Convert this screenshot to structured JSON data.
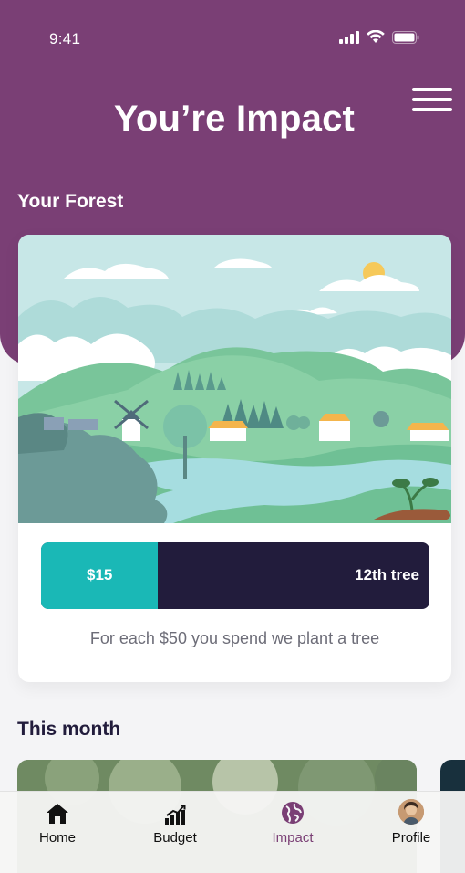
{
  "status_bar": {
    "time": "9:41",
    "icons": [
      "signal-icon",
      "wifi-icon",
      "battery-icon"
    ]
  },
  "header": {
    "title": "You’re Impact",
    "menu_icon": "hamburger-menu-icon",
    "background_color": "#7a3f75"
  },
  "forest": {
    "section_title": "Your Forest",
    "progress": {
      "amount_label": "$15",
      "target_label": "12th tree",
      "amount": 15,
      "per_tree": 50,
      "fill_color": "#1ab8b6",
      "track_color": "#221c3c"
    },
    "caption": "For each $50 you spend we plant a tree"
  },
  "this_month": {
    "section_title": "This month"
  },
  "tab_bar": {
    "tabs": [
      {
        "label": "Home",
        "icon": "home-icon",
        "active": false
      },
      {
        "label": "Budget",
        "icon": "budget-chart-icon",
        "active": false
      },
      {
        "label": "Impact",
        "icon": "globe-icon",
        "active": true
      },
      {
        "label": "Profile",
        "icon": "avatar",
        "active": false
      }
    ],
    "active_color": "#7a3f75"
  }
}
